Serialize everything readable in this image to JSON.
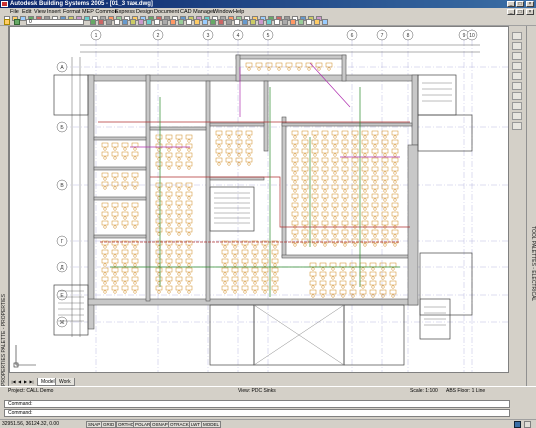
{
  "window": {
    "title": "Autodesk Building Systems 2005 - [01_3 таж.dwg]"
  },
  "menu": [
    "File",
    "Edit",
    "View",
    "Insert",
    "Format",
    "MEP Common",
    "Express",
    "Design",
    "Document",
    "CAD Manager",
    "Window",
    "Help"
  ],
  "toolbar": {
    "layer_value": "0"
  },
  "grid": {
    "top_columns": [
      "1",
      "2",
      "3",
      "4",
      "5",
      "6",
      "7",
      "8",
      "9",
      "10"
    ],
    "left_rows": [
      "А",
      "Б",
      "В",
      "Г",
      "Д",
      "Е",
      "Ж"
    ]
  },
  "palette": {
    "left_label": "PROPERTIES PALETTE - PROPERTIES",
    "right_label": "TOOL PALETTES - ELECTRICAL"
  },
  "tabs": [
    "Model",
    "Work"
  ],
  "viewbar": {
    "project": "Project: CALL Demo",
    "view": "View: PDC Sinks",
    "scale": "Scale: 1:100",
    "abs_floor": "ABS Floor: 1 Line"
  },
  "command": {
    "line1": "Command:",
    "line2": "Command:"
  },
  "status": {
    "coords": "32951.56, 36124.32, 0.00",
    "buttons": [
      "SNAP",
      "GRID",
      "ORTHO",
      "POLAR",
      "OSNAP",
      "OTRACK",
      "LWT",
      "MODEL"
    ]
  }
}
